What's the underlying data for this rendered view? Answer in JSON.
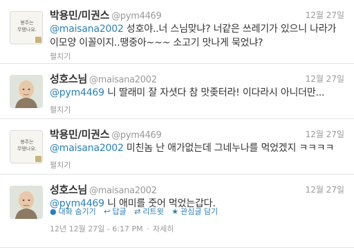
{
  "tweets": [
    {
      "name": "박용민/미권스",
      "handle": "@pym4469",
      "date": "12월 27일",
      "mention": "@maisana2002",
      "text": " 성호야..너 스님맞냐? 너같은 쓰레기가 있으니 나라가 이모양 이꼴이지..땡중아~~~ 소고기 맛나게 묵었냐?",
      "expand": "펼치기",
      "avatar_text": "봉주는\n무됐나요."
    },
    {
      "name": "성호스님",
      "handle": "@maisana2002",
      "date": "12월 27일",
      "mention": "@pym4469",
      "text": " 니 딸래미 잘 자셧다 참 맛좆터라! 이다라시 아니더만...",
      "expand": "펼치기"
    },
    {
      "name": "박용민/미권스",
      "handle": "@pym4469",
      "date": "12월 27일",
      "mention": "@maisana2002",
      "text": " 미친놈 난 애가없는데 그네누나를 먹었겠지 ㅋㅋㅋㅋ",
      "expand": "펼치기",
      "avatar_text": "봉주는\n무됐나요."
    },
    {
      "name": "성호스님",
      "handle": "@maisana2002",
      "date": "12월 27일",
      "mention": "@pym4469",
      "text": " 니 애미를 줏어 먹었는갑다.",
      "actions": [
        {
          "icon": "conversation-icon",
          "label": "대화 숨기기"
        },
        {
          "icon": "reply-icon",
          "label": "답글"
        },
        {
          "icon": "retweet-icon",
          "label": "리트윗"
        },
        {
          "icon": "star-icon",
          "label": "관심글 담기"
        }
      ],
      "meta": {
        "time": "12년 12월 27일 - 6:17 PM",
        "separator": "·",
        "detail": "자세히"
      }
    }
  ],
  "colors": {
    "link": "#2a7fb8",
    "muted": "#999999",
    "text": "#333333",
    "divider": "#e3e3e3"
  }
}
